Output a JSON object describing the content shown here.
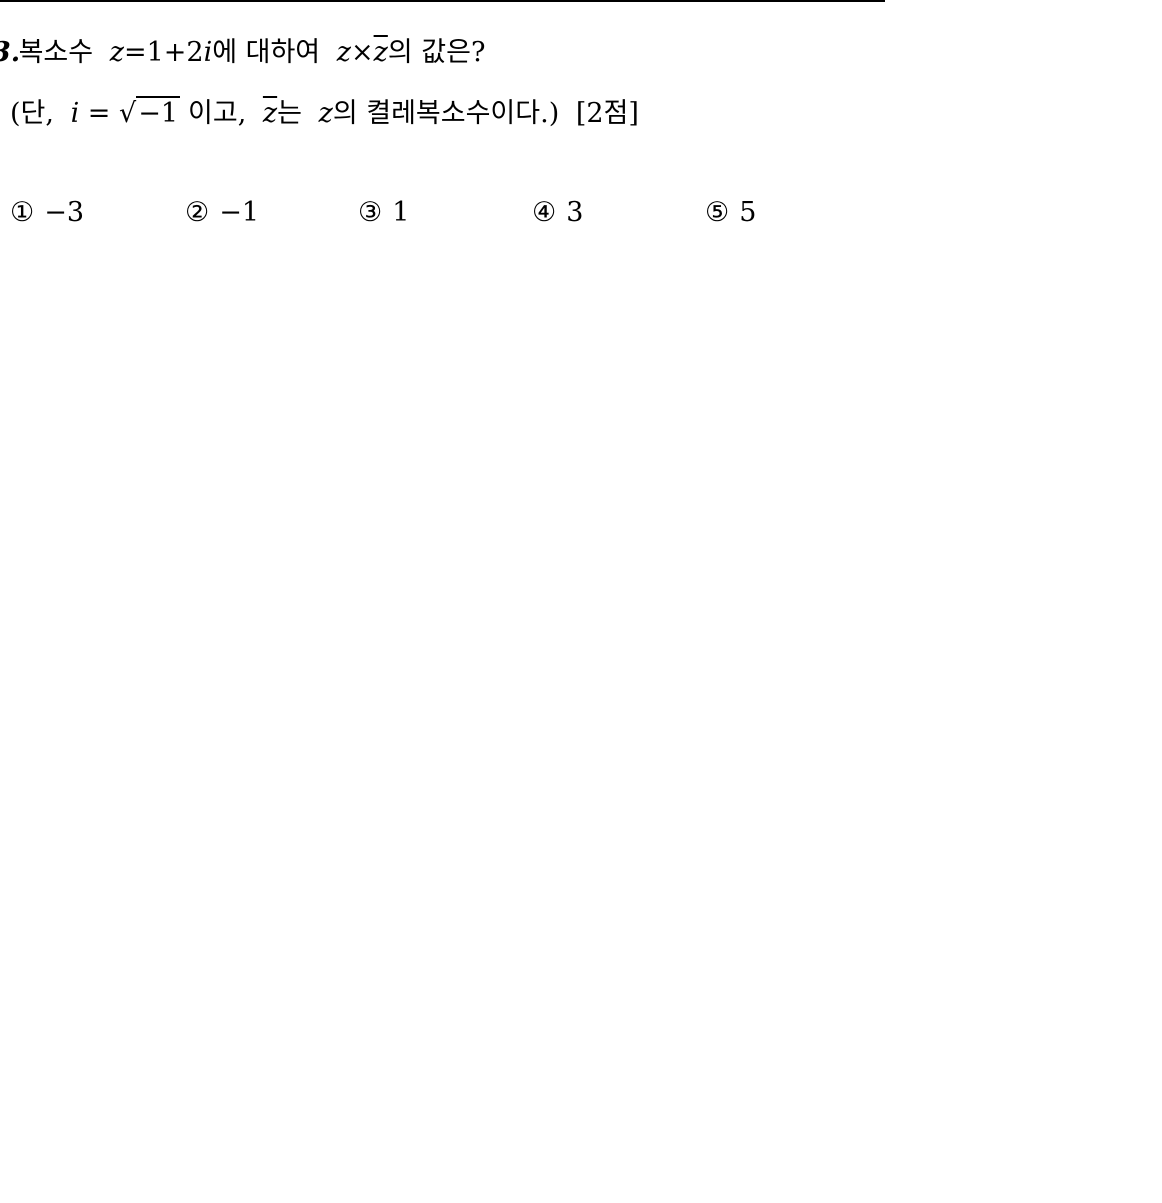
{
  "question": {
    "number": "3.",
    "line1": {
      "lead": "복소수",
      "z": "z",
      "equals": "=1+2",
      "i": "i",
      "postposition": "에 대하여",
      "z_again": "z",
      "times": "×",
      "z_bar": "z",
      "tail": "의 값은?"
    },
    "line2": {
      "open": "(단,",
      "i": "i",
      "equals": "=",
      "sqrt_sign": "√",
      "radicand": "−1",
      "mid": "이고,",
      "z_bar": "z",
      "neun": "는",
      "z": "z",
      "tail": "의 켤레복소수이다.)",
      "points": "[2점]"
    }
  },
  "choices": [
    {
      "marker": "①",
      "value": "−3"
    },
    {
      "marker": "②",
      "value": "−1"
    },
    {
      "marker": "③",
      "value": "1"
    },
    {
      "marker": "④",
      "value": "3"
    },
    {
      "marker": "⑤",
      "value": "5"
    }
  ]
}
